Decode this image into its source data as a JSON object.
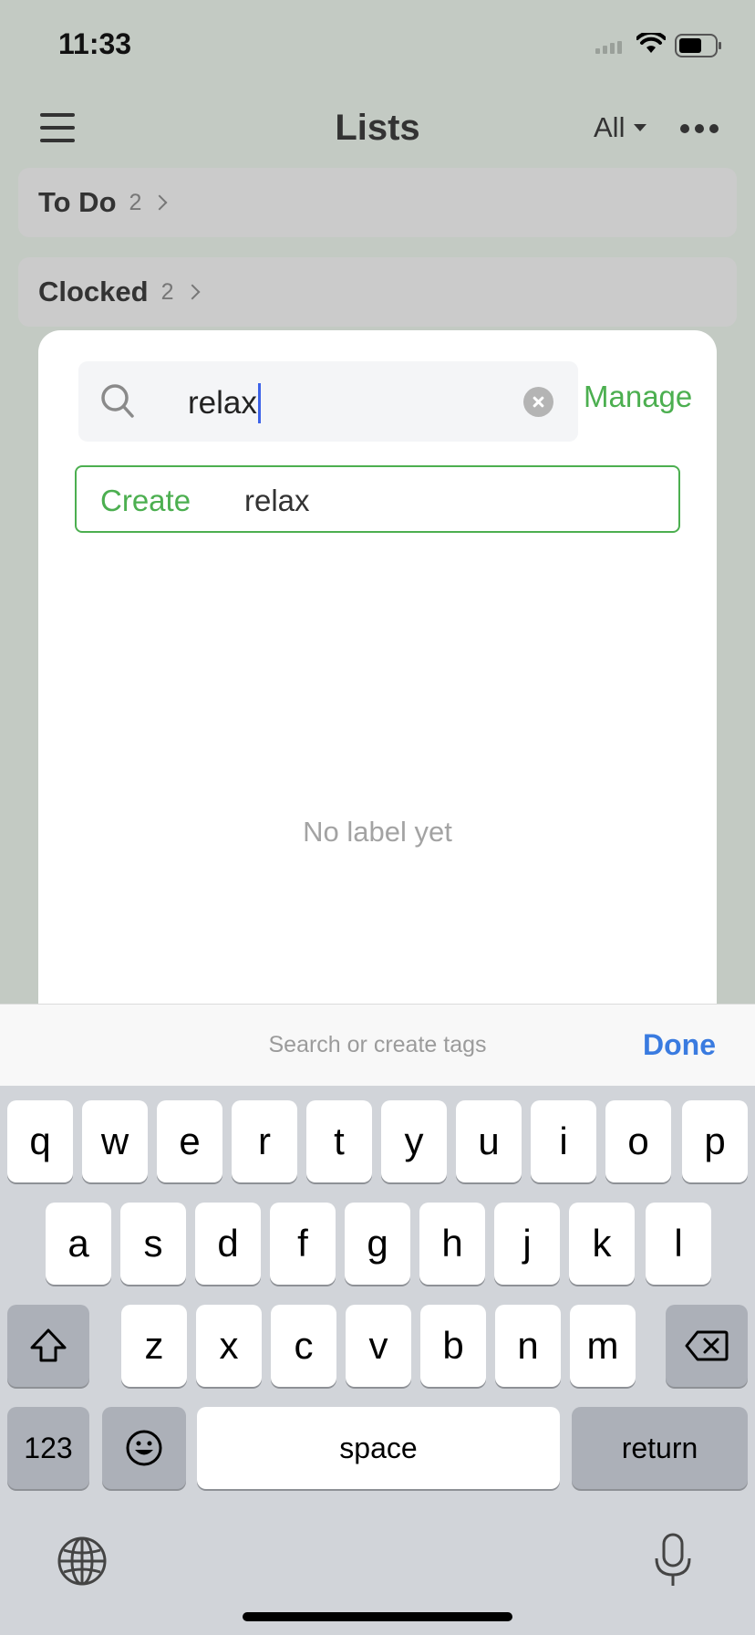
{
  "status_bar": {
    "time": "11:33"
  },
  "header": {
    "title": "Lists",
    "filter_label": "All"
  },
  "lists": [
    {
      "name": "To Do",
      "count": "2"
    },
    {
      "name": "Clocked",
      "count": "2"
    }
  ],
  "sheet": {
    "search_value": "relax",
    "manage_label": "Manage",
    "create_label": "Create",
    "create_value": "relax",
    "empty_message": "No label yet"
  },
  "accessory": {
    "placeholder": "Search or create tags",
    "done_label": "Done"
  },
  "keyboard": {
    "row1": [
      "q",
      "w",
      "e",
      "r",
      "t",
      "y",
      "u",
      "i",
      "o",
      "p"
    ],
    "row2": [
      "a",
      "s",
      "d",
      "f",
      "g",
      "h",
      "j",
      "k",
      "l"
    ],
    "row3": [
      "z",
      "x",
      "c",
      "v",
      "b",
      "n",
      "m"
    ],
    "numbers_label": "123",
    "space_label": "space",
    "return_label": "return"
  },
  "colors": {
    "accent_green": "#4caf50",
    "done_blue": "#3a7be0",
    "cursor_blue": "#3d63e8",
    "backdrop": "#c3cac3"
  }
}
